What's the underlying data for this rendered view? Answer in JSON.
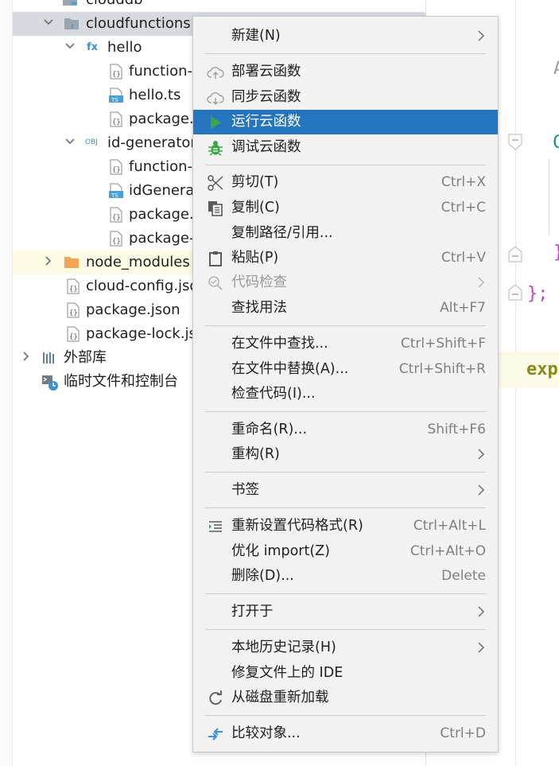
{
  "tree": {
    "rows": [
      {
        "label": "clouddb"
      },
      {
        "label": "cloudfunctions"
      },
      {
        "label": "hello"
      },
      {
        "label": "function-"
      },
      {
        "label": "hello.ts"
      },
      {
        "label": "package.j"
      },
      {
        "label": "id-generator"
      },
      {
        "label": "function-"
      },
      {
        "label": "idGenera"
      },
      {
        "label": "package.j"
      },
      {
        "label": "package-"
      },
      {
        "label": "node_modules"
      },
      {
        "label": "cloud-config.jso"
      },
      {
        "label": "package.json"
      },
      {
        "label": "package-lock.js"
      },
      {
        "label": "外部库"
      },
      {
        "label": "临时文件和控制台"
      }
    ],
    "icon_text": {
      "fx": "fx",
      "ts": "TS",
      "obj": "OBJ",
      "json": "{}"
    }
  },
  "editor": {
    "top_char": "A",
    "line1_char": "C",
    "brace_close": "}",
    "semi_line": "};",
    "export_text": "exp"
  },
  "menu": {
    "items": [
      {
        "label": "新建(N)",
        "shortcut": "",
        "submenu": true
      },
      {
        "label": "部署云函数",
        "shortcut": "",
        "icon": "cloud-upload-icon"
      },
      {
        "label": "同步云函数",
        "shortcut": "",
        "icon": "cloud-download-icon"
      },
      {
        "label": "运行云函数",
        "shortcut": "",
        "icon": "run-icon",
        "active": true
      },
      {
        "label": "调试云函数",
        "shortcut": "",
        "icon": "bug-icon"
      },
      {
        "label": "剪切(T)",
        "shortcut": "Ctrl+X",
        "icon": "scissors-icon"
      },
      {
        "label": "复制(C)",
        "shortcut": "Ctrl+C",
        "icon": "copy-icon"
      },
      {
        "label": "复制路径/引用...",
        "shortcut": ""
      },
      {
        "label": "粘贴(P)",
        "shortcut": "Ctrl+V",
        "icon": "paste-icon"
      },
      {
        "label": "代码检查",
        "shortcut": "",
        "icon": "inspect-icon",
        "submenu": true,
        "disabled": true
      },
      {
        "label": "查找用法",
        "shortcut": "Alt+F7"
      },
      {
        "label": "在文件中查找...",
        "shortcut": "Ctrl+Shift+F"
      },
      {
        "label": "在文件中替换(A)...",
        "shortcut": "Ctrl+Shift+R"
      },
      {
        "label": "检查代码(I)...",
        "shortcut": ""
      },
      {
        "label": "重命名(R)...",
        "shortcut": "Shift+F6"
      },
      {
        "label": "重构(R)",
        "shortcut": "",
        "submenu": true
      },
      {
        "label": "书签",
        "shortcut": "",
        "submenu": true
      },
      {
        "label": "重新设置代码格式(R)",
        "shortcut": "Ctrl+Alt+L",
        "icon": "reformat-icon"
      },
      {
        "label": "优化 import(Z)",
        "shortcut": "Ctrl+Alt+O"
      },
      {
        "label": "删除(D)...",
        "shortcut": "Delete"
      },
      {
        "label": "打开于",
        "shortcut": "",
        "submenu": true
      },
      {
        "label": "本地历史记录(H)",
        "shortcut": "",
        "submenu": true
      },
      {
        "label": "修复文件上的 IDE",
        "shortcut": ""
      },
      {
        "label": "从磁盘重新加载",
        "shortcut": "",
        "icon": "reload-icon"
      },
      {
        "label": "比较对象...",
        "shortcut": "Ctrl+D",
        "icon": "compare-icon"
      }
    ]
  },
  "colors": {
    "menu_bg": "#f2f2f2",
    "active_bg": "#2675bf",
    "selected_row": "#d6d9dd",
    "run_green": "#3da44a",
    "folder_gray": "#9aa7b0",
    "folder_orange": "#f3a553",
    "ts_blue": "#4a9fd8"
  }
}
